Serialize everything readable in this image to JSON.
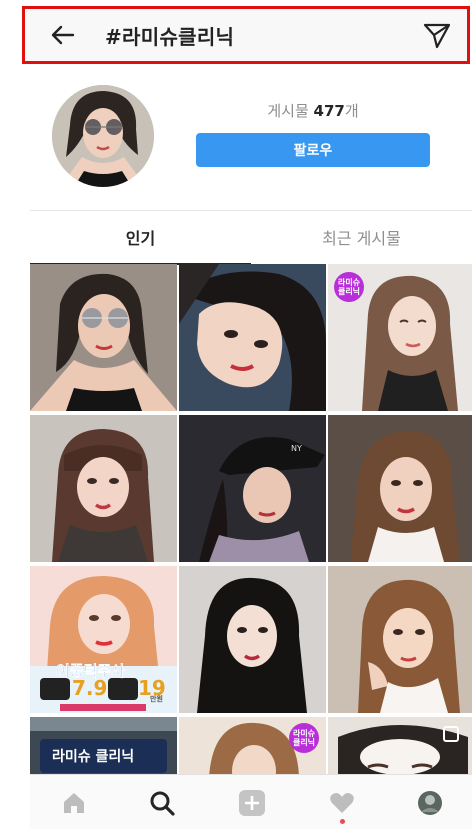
{
  "header": {
    "title": "#라미슈클리닉",
    "back_icon": "back-arrow-icon",
    "share_icon": "send-icon"
  },
  "profile": {
    "posts_label": "게시물 ",
    "posts_count": "477",
    "posts_suffix": "개",
    "follow_label": "팔로우"
  },
  "tabs": [
    {
      "label": "인기"
    },
    {
      "label": "최근 게시물"
    }
  ],
  "grid": {
    "badge_text_1": "라미슈\n클리닉",
    "badge_text_2": "라미슈\n클리닉",
    "ad_headline": "이중턱주사",
    "ad_price_1": "7.9",
    "ad_price_2": "19",
    "ad_unit": "만원",
    "ad_logo_text": "라미슈 클리닉"
  },
  "colors": {
    "follow": "#3897f0",
    "badge": "#b82fd9",
    "highlight_border": "#e01010",
    "notification": "#ed4956"
  }
}
